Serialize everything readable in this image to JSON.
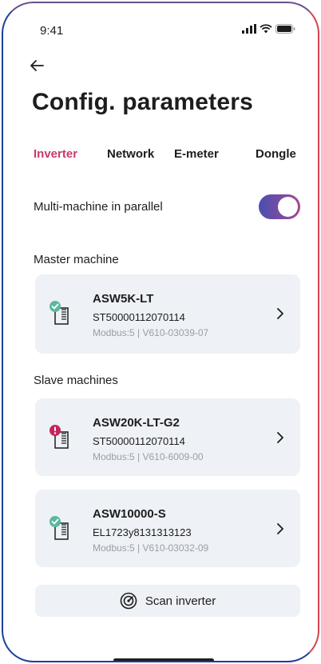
{
  "status_bar": {
    "time": "9:41"
  },
  "header": {
    "title": "Config. parameters"
  },
  "tabs": [
    {
      "label": "Inverter",
      "active": true
    },
    {
      "label": "Network",
      "active": false
    },
    {
      "label": "E-meter",
      "active": false
    },
    {
      "label": "Dongle",
      "active": false
    }
  ],
  "parallel": {
    "label": "Multi-machine in parallel",
    "enabled": true
  },
  "master": {
    "section_label": "Master  machine",
    "device": {
      "name": "ASW5K-LT",
      "serial": "ST50000112070114",
      "meta": "Modbus:5 | V610-03039-07",
      "status": "ok"
    }
  },
  "slaves": {
    "section_label": "Slave machines",
    "devices": [
      {
        "name": "ASW20K-LT-G2",
        "serial": "ST50000112070114",
        "meta": "Modbus:5 | V610-6009-00",
        "status": "error"
      },
      {
        "name": "ASW10000-S",
        "serial": "EL1723y8131313123",
        "meta": "Modbus:5 | V610-03032-09",
        "status": "ok"
      }
    ]
  },
  "scan_button": {
    "label": "Scan inverter",
    "icon": "radar-icon"
  },
  "colors": {
    "accent": "#c8386b",
    "ok": "#5bb7a0",
    "error": "#c8235a",
    "card": "#eef1f5"
  }
}
